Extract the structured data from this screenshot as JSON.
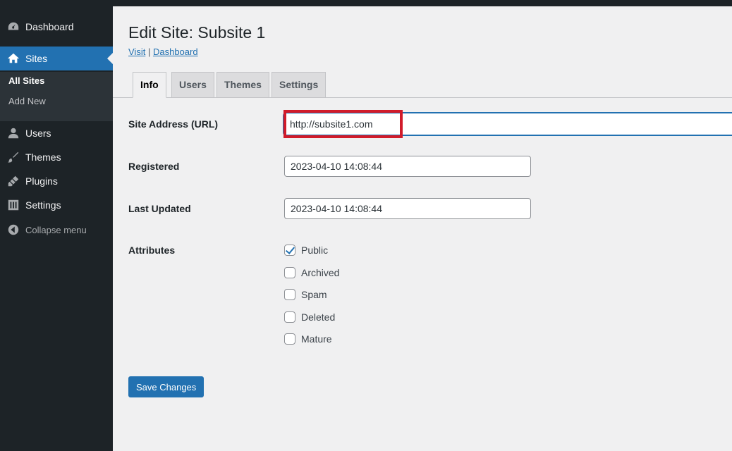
{
  "sidebar": {
    "dashboard": "Dashboard",
    "sites": "Sites",
    "submenu": {
      "all_sites": "All Sites",
      "add_new": "Add New"
    },
    "users": "Users",
    "themes": "Themes",
    "plugins": "Plugins",
    "settings": "Settings",
    "collapse": "Collapse menu"
  },
  "header": {
    "title": "Edit Site: Subsite 1",
    "visit_link": "Visit",
    "separator": "|",
    "dashboard_link": "Dashboard"
  },
  "tabs": [
    "Info",
    "Users",
    "Themes",
    "Settings"
  ],
  "form": {
    "site_address_label": "Site Address (URL)",
    "site_address_value": "http://subsite1.com",
    "registered_label": "Registered",
    "registered_value": "2023-04-10 14:08:44",
    "last_updated_label": "Last Updated",
    "last_updated_value": "2023-04-10 14:08:44",
    "attributes_label": "Attributes",
    "attributes": [
      {
        "label": "Public",
        "checked": true
      },
      {
        "label": "Archived",
        "checked": false
      },
      {
        "label": "Spam",
        "checked": false
      },
      {
        "label": "Deleted",
        "checked": false
      },
      {
        "label": "Mature",
        "checked": false
      }
    ]
  },
  "save_button": "Save Changes",
  "colors": {
    "accent": "#2271b1",
    "sidebar": "#1d2327",
    "highlight": "#d11b2a"
  }
}
